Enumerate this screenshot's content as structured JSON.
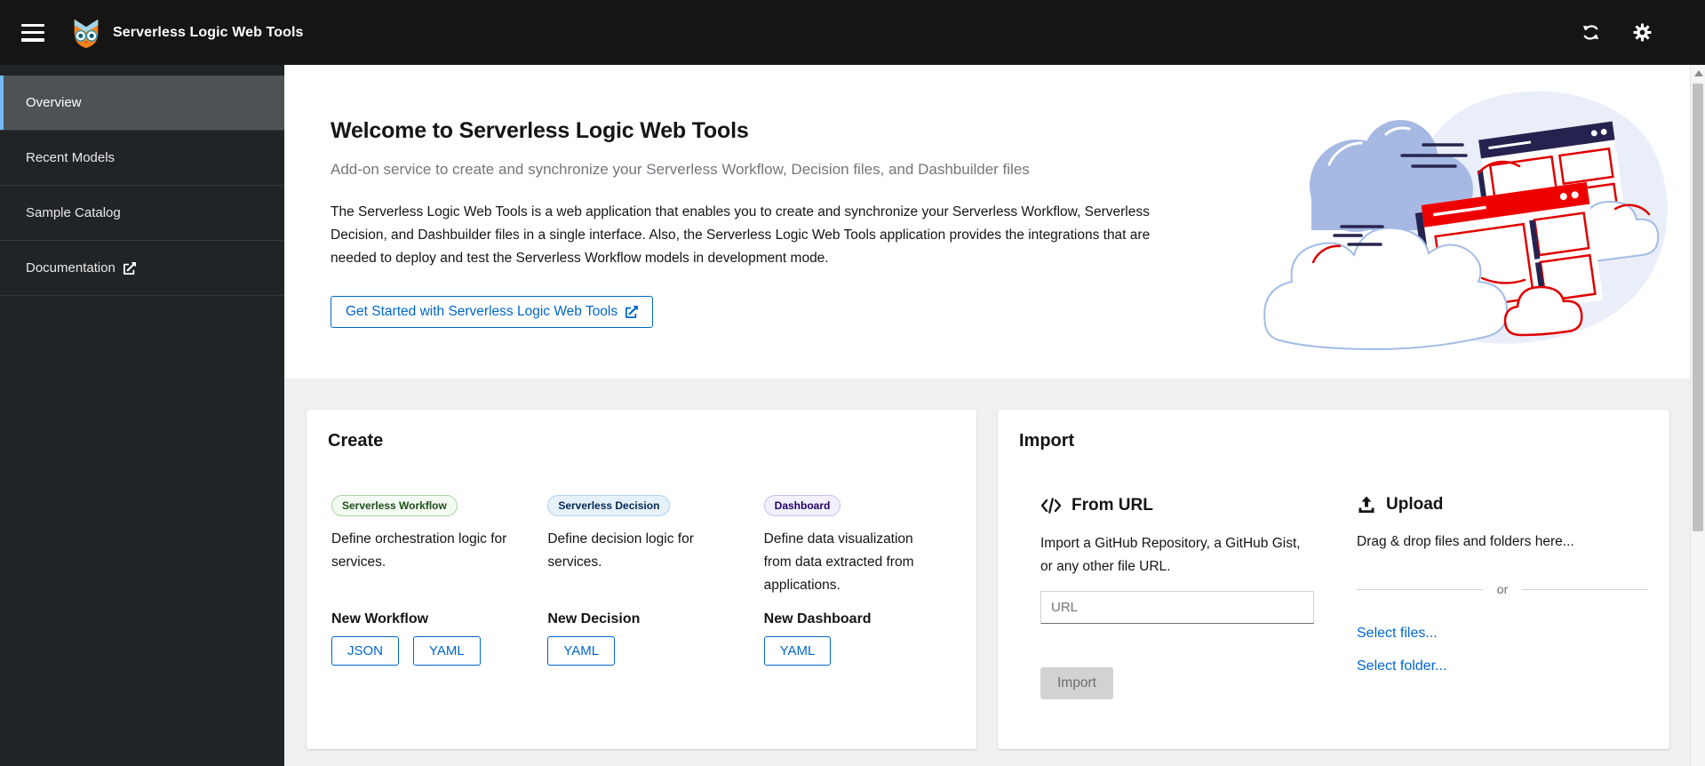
{
  "masthead": {
    "title": "Serverless Logic Web Tools",
    "icons": {
      "logo": "owl-logo-icon",
      "right": [
        "sync-icon",
        "settings-gear-icon"
      ]
    }
  },
  "sidebar": {
    "items": [
      {
        "label": "Overview",
        "selected": true
      },
      {
        "label": "Recent Models",
        "selected": false
      },
      {
        "label": "Sample Catalog",
        "selected": false
      },
      {
        "label": "Documentation",
        "selected": false,
        "external": true
      }
    ]
  },
  "welcome": {
    "title": "Welcome to Serverless Logic Web Tools",
    "subtitle": "Add-on service to create and synchronize your Serverless Workflow, Decision files, and Dashbuilder files",
    "body": "The Serverless Logic Web Tools is a web application that enables you to create and synchronize your Serverless Workflow, Serverless Decision, and Dashbuilder files in a single interface. Also, the Serverless Logic Web Tools application provides the integrations that are needed to deploy and test the Serverless Workflow models in development mode.",
    "cta_label": "Get Started with Serverless Logic Web Tools"
  },
  "create_card": {
    "title": "Create",
    "columns": [
      {
        "badge": "Serverless Workflow",
        "badge_color": "green",
        "description": "Define orchestration logic for services.",
        "action_label": "New Workflow",
        "buttons": [
          "JSON",
          "YAML"
        ]
      },
      {
        "badge": "Serverless Decision",
        "badge_color": "blue",
        "description": "Define decision logic for services.",
        "action_label": "New Decision",
        "buttons": [
          "YAML"
        ]
      },
      {
        "badge": "Dashboard",
        "badge_color": "purple",
        "description": "Define data visualization from data extracted from applications.",
        "action_label": "New Dashboard",
        "buttons": [
          "YAML"
        ]
      }
    ]
  },
  "import_card": {
    "title": "Import",
    "from_url": {
      "heading": "From URL",
      "description": "Import a GitHub Repository, a GitHub Gist, or any other file URL.",
      "input_placeholder": "URL",
      "input_value": "",
      "button_label": "Import",
      "button_disabled": true
    },
    "upload": {
      "heading": "Upload",
      "description": "Drag & drop files and folders here...",
      "divider_label": "or",
      "links": [
        "Select files...",
        "Select folder..."
      ]
    }
  },
  "colors": {
    "masthead_bg": "#151515",
    "sidebar_bg": "#212427",
    "sidebar_selected_bg": "#4f5255",
    "sidebar_selected_accent": "#73bcf7",
    "accent_blue": "#0066cc",
    "section_bg": "#f0f0f0",
    "text_secondary": "#6a6e73",
    "badge_green_text": "#1e4f18",
    "badge_blue_text": "#002952",
    "badge_purple_text": "#1f0066",
    "disabled_bg": "#d2d2d2"
  }
}
